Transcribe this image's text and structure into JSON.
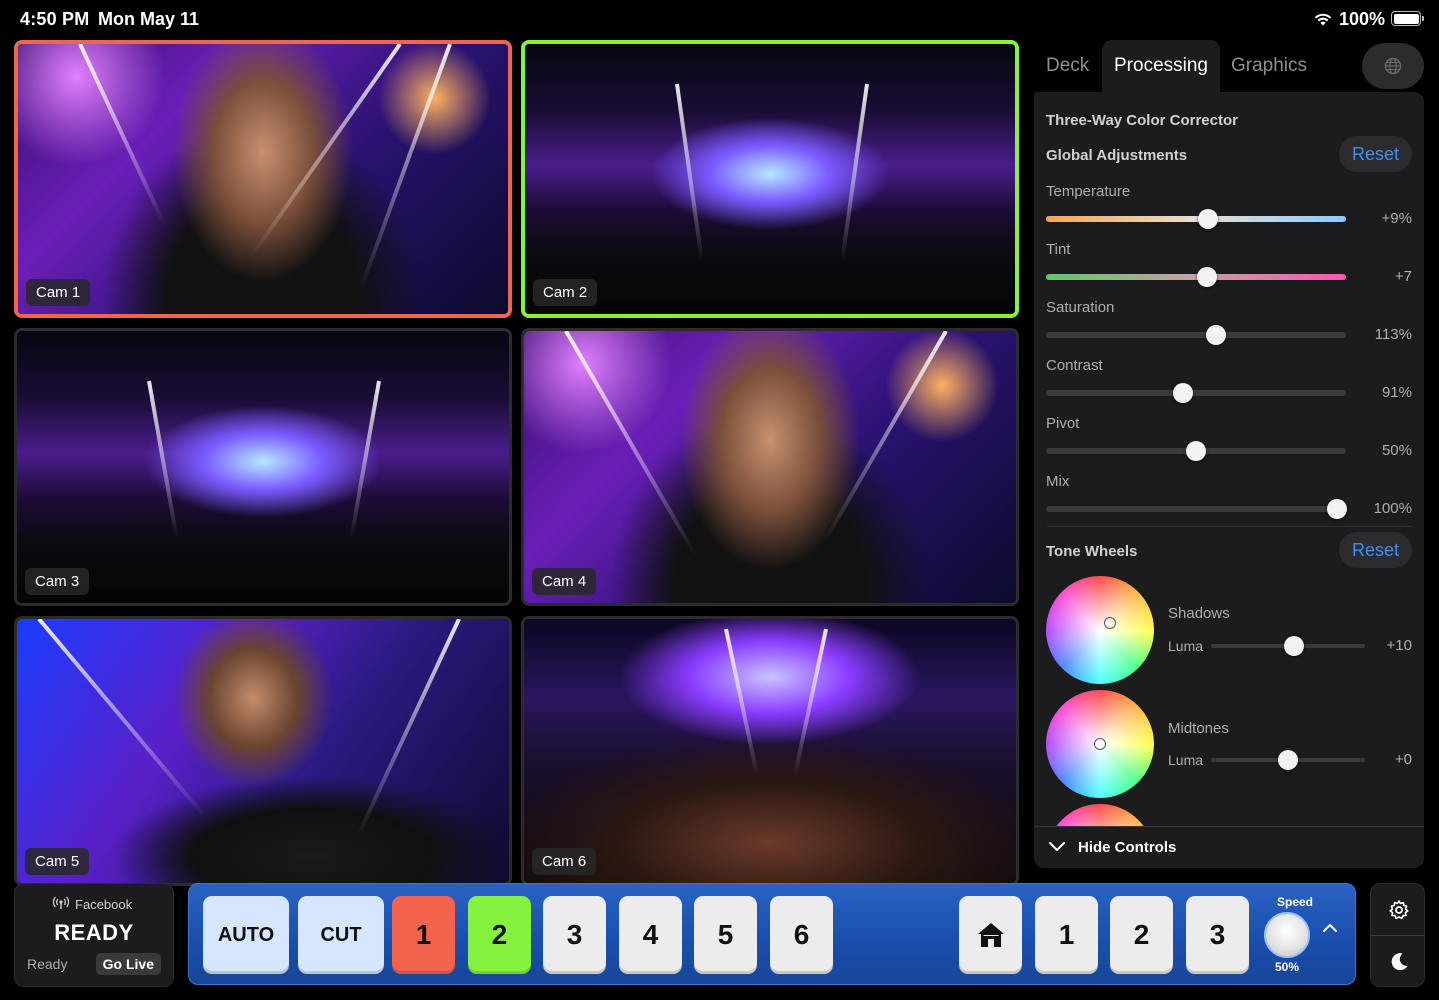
{
  "status_bar": {
    "time": "4:50 PM",
    "date": "Mon May 11",
    "battery": "100%"
  },
  "cameras": [
    {
      "label": "Cam 1",
      "state": "program"
    },
    {
      "label": "Cam 2",
      "state": "preview"
    },
    {
      "label": "Cam 3",
      "state": "idle"
    },
    {
      "label": "Cam 4",
      "state": "idle"
    },
    {
      "label": "Cam 5",
      "state": "idle"
    },
    {
      "label": "Cam 6",
      "state": "idle"
    }
  ],
  "panel": {
    "tabs": [
      "Deck",
      "Processing",
      "Graphics"
    ],
    "active_tab": "Processing",
    "title": "Three-Way Color Corrector",
    "global": {
      "title": "Global Adjustments",
      "reset": "Reset",
      "params": [
        {
          "label": "Temperature",
          "value": "+9%",
          "position": 0.54
        },
        {
          "label": "Tint",
          "value": "+7",
          "position": 0.535
        },
        {
          "label": "Saturation",
          "value": "113%",
          "position": 0.565
        },
        {
          "label": "Contrast",
          "value": "91%",
          "position": 0.455
        },
        {
          "label": "Pivot",
          "value": "50%",
          "position": 0.5
        },
        {
          "label": "Mix",
          "value": "100%",
          "position": 0.97
        }
      ]
    },
    "tone": {
      "title": "Tone Wheels",
      "reset": "Reset",
      "wheels": [
        {
          "name": "Shadows",
          "luma_label": "Luma",
          "luma_value": "+10",
          "luma_position": 0.54
        },
        {
          "name": "Midtones",
          "luma_label": "Luma",
          "luma_value": "+0",
          "luma_position": 0.5
        }
      ]
    },
    "hide_controls": "Hide Controls"
  },
  "stream": {
    "platform": "Facebook",
    "status_big": "READY",
    "status_small": "Ready",
    "go_live": "Go Live"
  },
  "switcher": {
    "auto": "AUTO",
    "cut": "CUT",
    "inputs": [
      "1",
      "2",
      "3",
      "4",
      "5",
      "6"
    ],
    "program_input": "1",
    "preview_input": "2",
    "presets": [
      "1",
      "2",
      "3"
    ],
    "speed_label": "Speed",
    "speed_value": "50%"
  },
  "colors": {
    "program": "#f4634d",
    "preview": "#86f240",
    "accent": "#3d8ef7",
    "switcher_bg": "#1a4fae"
  }
}
